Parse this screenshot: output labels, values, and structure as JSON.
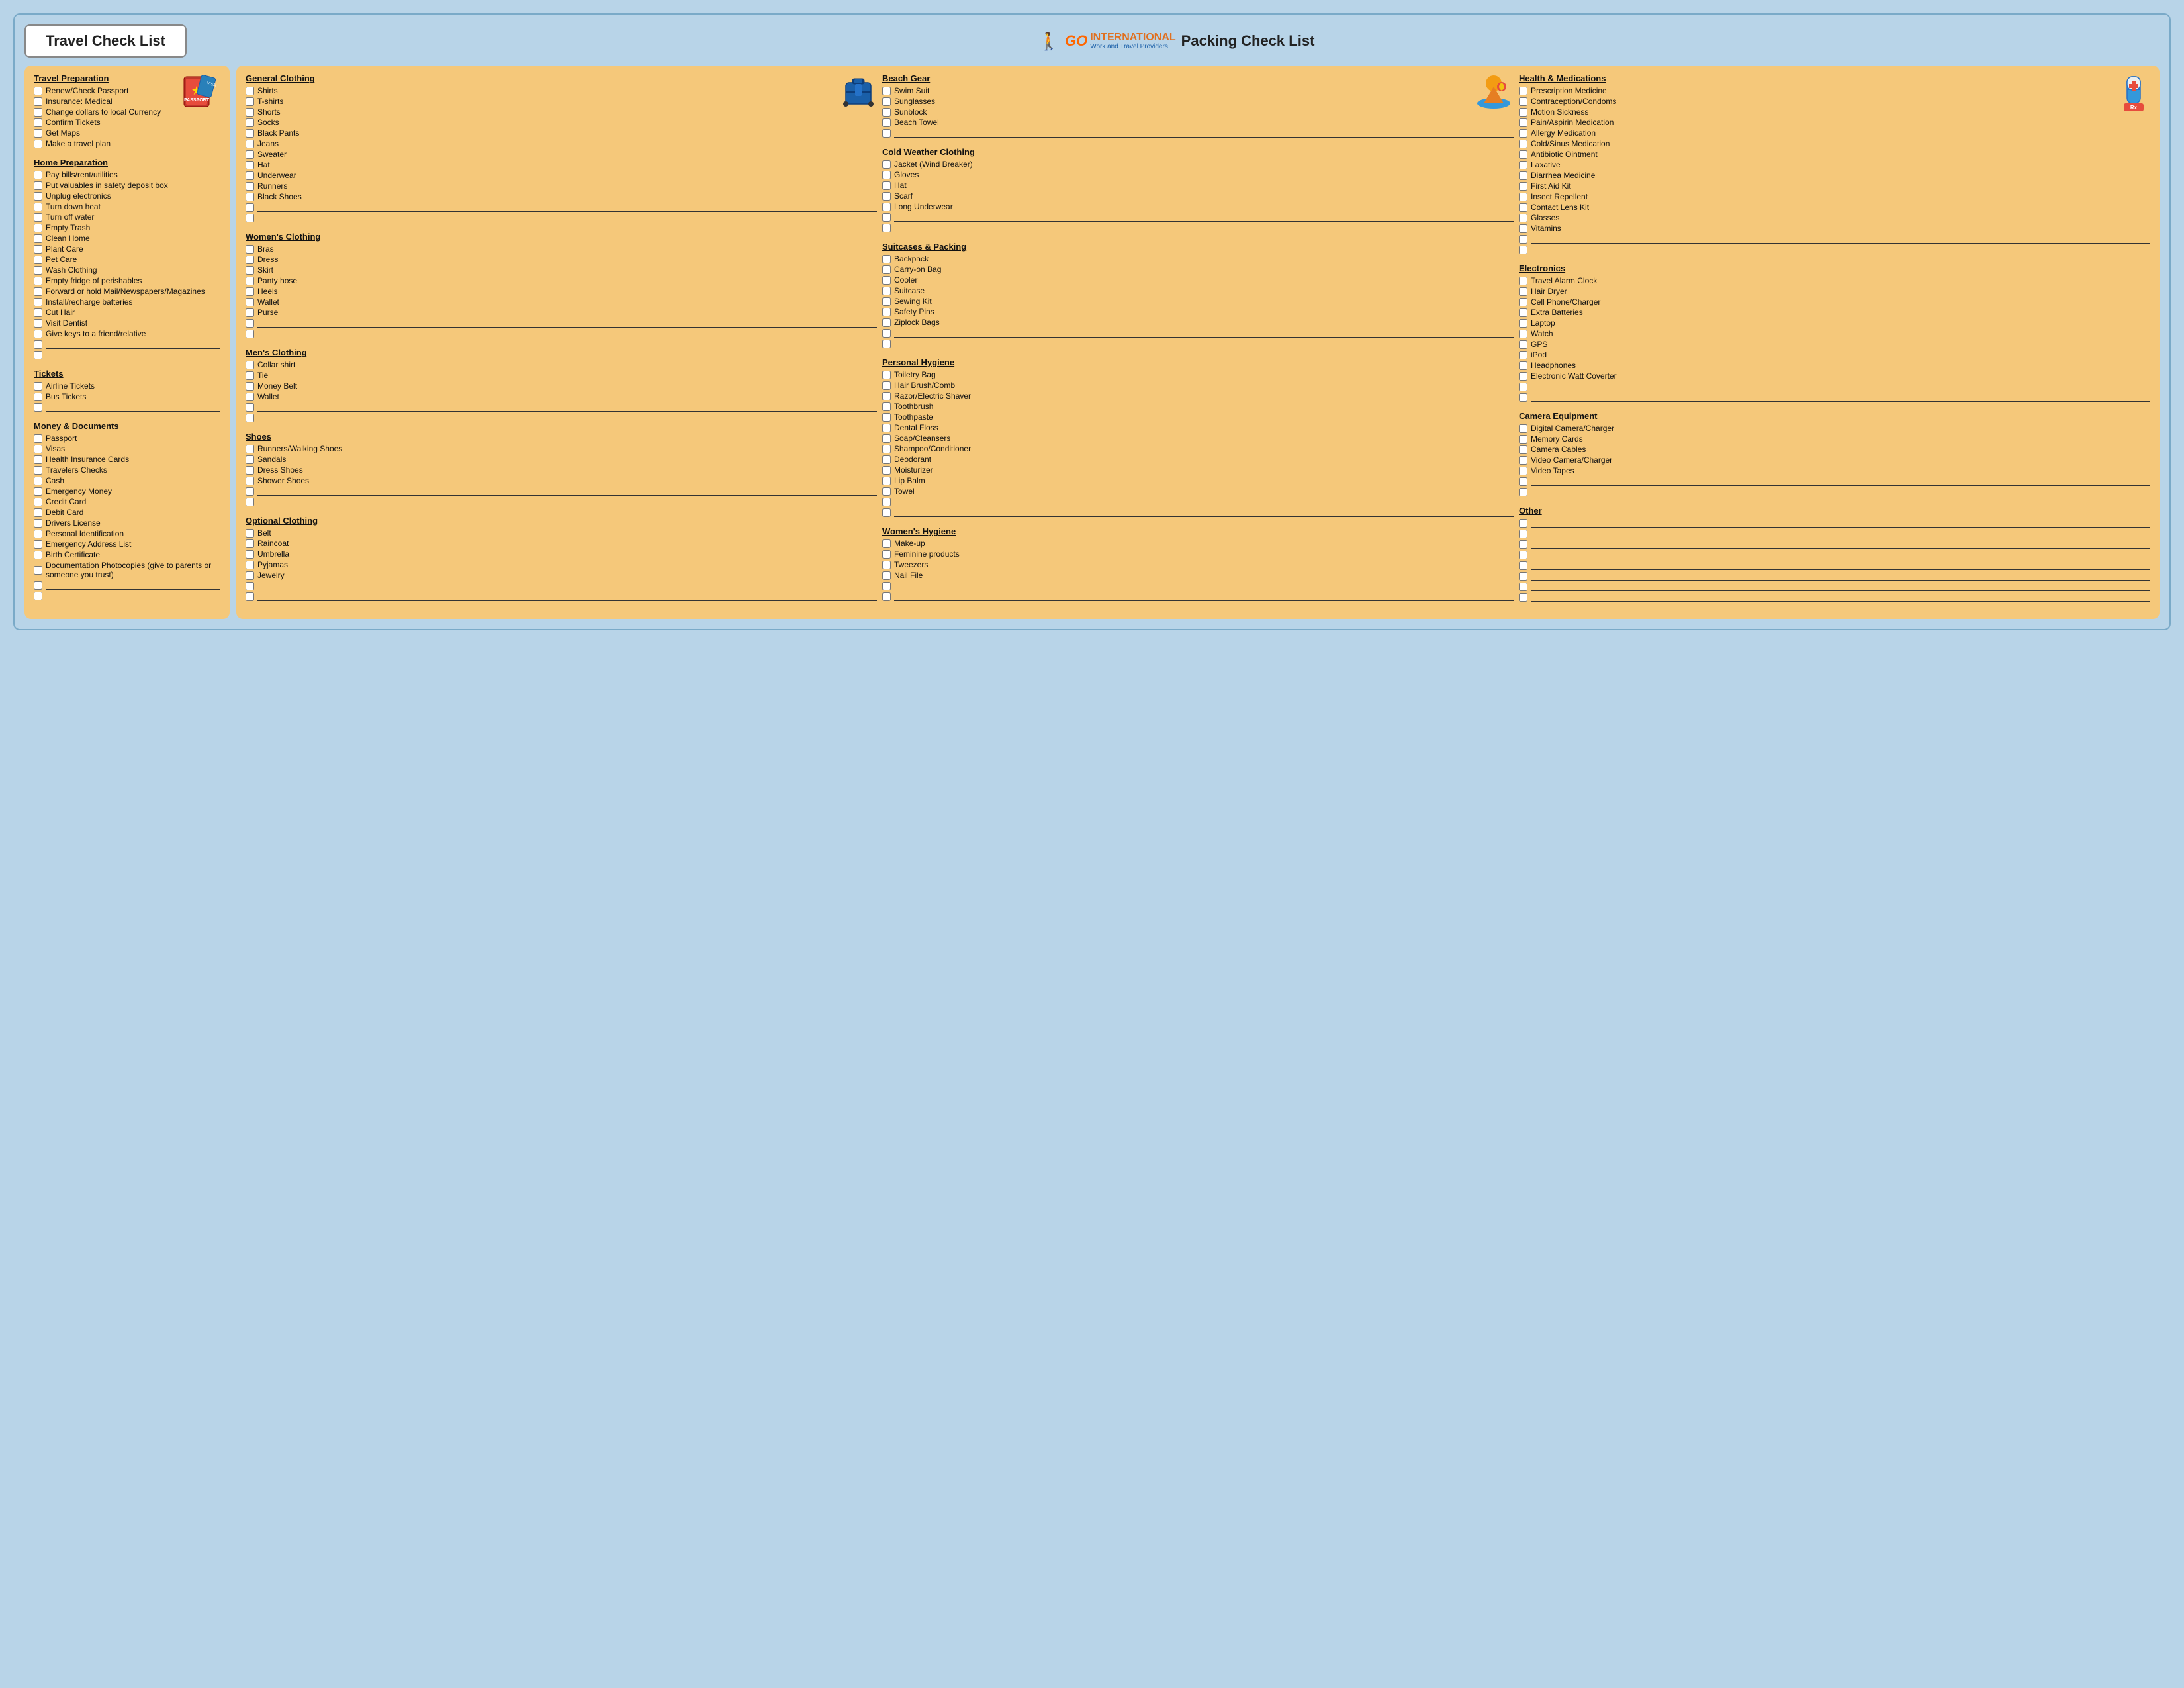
{
  "header": {
    "travel_title": "Travel Check List",
    "packing_title": "Packing Check List",
    "logo_go": "GO",
    "logo_international": "INTERNATIONAL",
    "logo_sub": "Work and Travel Providers"
  },
  "left": {
    "sections": [
      {
        "id": "travel-preparation",
        "title": "Travel Preparation",
        "items": [
          "Renew/Check Passport",
          "Insurance: Medical",
          "Change dollars to local Currency",
          "Confirm Tickets",
          "Get Maps",
          "Make a travel plan"
        ],
        "blanks": 0
      },
      {
        "id": "home-preparation",
        "title": "Home Preparation",
        "items": [
          "Pay bills/rent/utilities",
          "Put valuables in safety deposit box",
          "Unplug electronics",
          "Turn down heat",
          "Turn off water",
          "Empty Trash",
          "Clean Home",
          "Plant Care",
          "Pet Care",
          "Wash Clothing",
          "Empty fridge of perishables",
          "Forward or hold Mail/Newspapers/Magazines",
          "Install/recharge batteries",
          "Cut Hair",
          "Visit Dentist",
          "Give keys to a friend/relative"
        ],
        "blanks": 2
      },
      {
        "id": "tickets",
        "title": "Tickets",
        "items": [
          "Airline Tickets",
          "Bus Tickets"
        ],
        "blanks": 1
      },
      {
        "id": "money-documents",
        "title": "Money & Documents",
        "items": [
          "Passport",
          "Visas",
          "Health Insurance Cards",
          "Travelers Checks",
          "Cash",
          "Emergency Money",
          "Credit Card",
          "Debit Card",
          "Drivers License",
          "Personal Identification",
          "Emergency Address List",
          "Birth Certificate",
          "Documentation Photocopies (give to parents or someone you trust)"
        ],
        "blanks": 2
      }
    ]
  },
  "right": {
    "col1": {
      "sections": [
        {
          "id": "general-clothing",
          "title": "General Clothing",
          "items": [
            "Shirts",
            "T-shirts",
            "Shorts",
            "Socks",
            "Black Pants",
            "Jeans",
            "Sweater",
            "Hat",
            "Underwear",
            "Runners",
            "Black Shoes"
          ],
          "blanks": 2
        },
        {
          "id": "womens-clothing",
          "title": "Women's Clothing",
          "items": [
            "Bras",
            "Dress",
            "Skirt",
            "Panty hose",
            "Heels",
            "Wallet",
            "Purse"
          ],
          "blanks": 2
        },
        {
          "id": "mens-clothing",
          "title": "Men's Clothing",
          "items": [
            "Collar shirt",
            "Tie",
            "Money Belt",
            "Wallet"
          ],
          "blanks": 2
        },
        {
          "id": "shoes",
          "title": "Shoes",
          "items": [
            "Runners/Walking Shoes",
            "Sandals",
            "Dress Shoes",
            "Shower Shoes"
          ],
          "blanks": 2
        },
        {
          "id": "optional-clothing",
          "title": "Optional Clothing",
          "items": [
            "Belt",
            "Raincoat",
            "Umbrella",
            "Pyjamas",
            "Jewelry"
          ],
          "blanks": 2
        }
      ]
    },
    "col2": {
      "sections": [
        {
          "id": "beach-gear",
          "title": "Beach Gear",
          "items": [
            "Swim Suit",
            "Sunglasses",
            "Sunblock",
            "Beach Towel"
          ],
          "blanks": 1
        },
        {
          "id": "cold-weather-clothing",
          "title": "Cold Weather Clothing",
          "items": [
            "Jacket (Wind Breaker)",
            "Gloves",
            "Hat",
            "Scarf",
            "Long Underwear"
          ],
          "blanks": 2
        },
        {
          "id": "suitcases-packing",
          "title": "Suitcases & Packing",
          "items": [
            "Backpack",
            "Carry-on Bag",
            "Cooler",
            "Suitcase",
            "Sewing Kit",
            "Safety Pins",
            "Ziplock Bags"
          ],
          "blanks": 2
        },
        {
          "id": "personal-hygiene",
          "title": "Personal Hygiene",
          "items": [
            "Toiletry Bag",
            "Hair Brush/Comb",
            "Razor/Electric Shaver",
            "Toothbrush",
            "Toothpaste",
            "Dental Floss",
            "Soap/Cleansers",
            "Shampoo/Conditioner",
            "Deodorant",
            "Moisturizer",
            "Lip Balm",
            "Towel"
          ],
          "blanks": 2
        },
        {
          "id": "womens-hygiene",
          "title": "Women's Hygiene",
          "items": [
            "Make-up",
            "Feminine products",
            "Tweezers",
            "Nail File"
          ],
          "blanks": 2
        }
      ]
    },
    "col3": {
      "sections": [
        {
          "id": "health-medications",
          "title": "Health & Medications",
          "items": [
            "Prescription Medicine",
            "Contraception/Condoms",
            "Motion Sickness",
            "Pain/Aspirin Medication",
            "Allergy Medication",
            "Cold/Sinus Medication",
            "Antibiotic Ointment",
            "Laxative",
            "Diarrhea Medicine",
            "First Aid Kit",
            "Insect Repellent",
            "Contact Lens Kit",
            "Glasses",
            "Vitamins"
          ],
          "blanks": 2
        },
        {
          "id": "electronics",
          "title": "Electronics",
          "items": [
            "Travel Alarm Clock",
            "Hair Dryer",
            "Cell Phone/Charger",
            "Extra Batteries",
            "Laptop",
            "Watch",
            "GPS",
            "iPod",
            "Headphones",
            "Electronic Watt Coverter"
          ],
          "blanks": 2
        },
        {
          "id": "camera-equipment",
          "title": "Camera Equipment",
          "items": [
            "Digital Camera/Charger",
            "Memory Cards",
            "Camera Cables",
            "Video Camera/Charger",
            "Video Tapes"
          ],
          "blanks": 2
        },
        {
          "id": "other",
          "title": "Other",
          "items": [],
          "blanks": 8
        }
      ]
    }
  }
}
